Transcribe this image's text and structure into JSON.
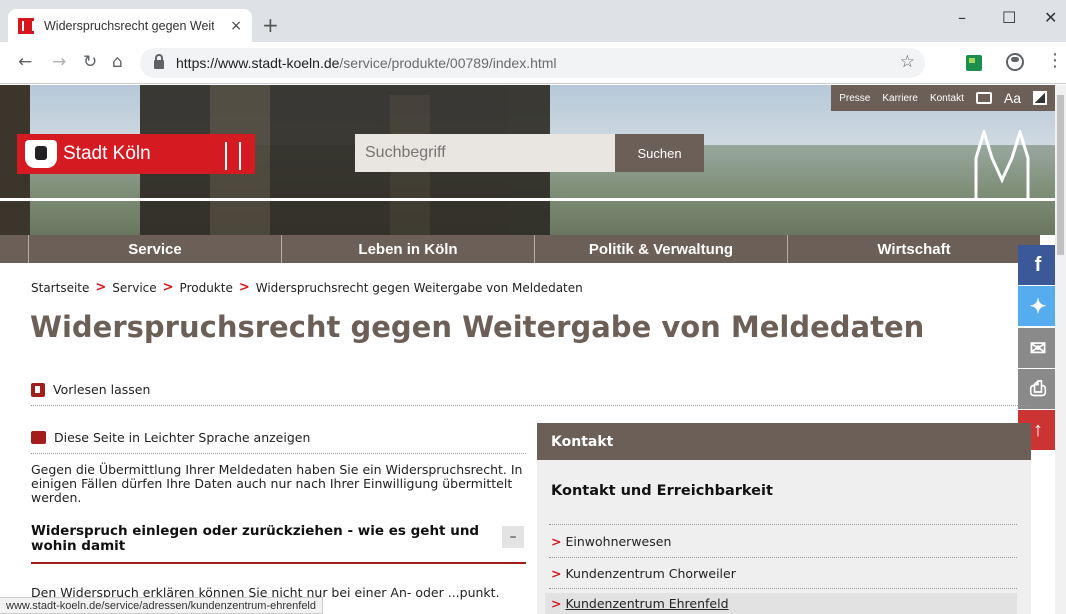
{
  "browser": {
    "tab_title": "Widerspruchsrecht gegen Weiter",
    "tab_close": "×",
    "new_tab": "+",
    "url_host": "https://www.stadt-koeln.de",
    "url_path": "/service/produkte/00789/index.html",
    "status_url": "www.stadt-koeln.de/service/adressen/kundenzentrum-ehrenfeld",
    "window_controls": [
      "–",
      "☐",
      "✕"
    ]
  },
  "site": {
    "logo_text": "Stadt Köln",
    "search_placeholder": "Suchbegriff",
    "search_button": "Suchen",
    "top_links": [
      "Presse",
      "Karriere",
      "Kontakt"
    ],
    "font_toggle": "Aa"
  },
  "nav": [
    "Service",
    "Leben in Köln",
    "Politik & Verwaltung",
    "Wirtschaft"
  ],
  "breadcrumb": [
    "Startseite",
    "Service",
    "Produkte",
    "Widerspruchsrecht gegen Weitergabe von Meldedaten"
  ],
  "breadcrumb_sep": ">",
  "page_title": "Widerspruchsrecht gegen Weitergabe von Meldedaten",
  "read_aloud": "Vorlesen lassen",
  "easy_language": "Diese Seite in Leichter Sprache anzeigen",
  "intro_text": "Gegen die Übermittlung Ihrer Meldedaten haben Sie ein Widerspruchsrecht. In einigen Fällen dürfen Ihre Daten auch nur nach Ihrer Einwilligung übermittelt werden.",
  "section_heading": "Widerspruch einlegen oder zurückziehen - wie es geht und wohin damit",
  "section_toggle": "–",
  "body_text": "Den Widerspruch erklären können Sie nicht nur bei einer An- oder ...punkt. Gleiches gilt für die",
  "contact": {
    "header": "Kontakt",
    "subheader": "Kontakt und Erreichbarkeit",
    "items": [
      "Einwohnerwesen",
      "Kundenzentrum Chorweiler",
      "Kundenzentrum Ehrenfeld"
    ],
    "chevron": ">"
  },
  "social": {
    "facebook": "f",
    "twitter": "✦",
    "mail": "✉",
    "print": "⎙",
    "up": "↑"
  }
}
